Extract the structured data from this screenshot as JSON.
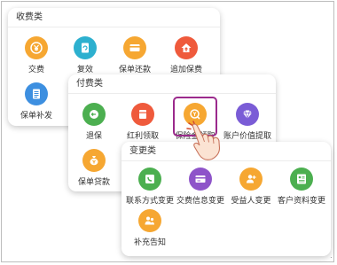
{
  "panels": {
    "shoufei": {
      "title": "收费类",
      "items": [
        {
          "label": "交费",
          "icon": "yen-circle-icon",
          "color": "#f6a732"
        },
        {
          "label": "复效",
          "icon": "refresh-document-icon",
          "color": "#2db0cf"
        },
        {
          "label": "保单还款",
          "icon": "card-icon",
          "color": "#f6a732"
        },
        {
          "label": "追加保费",
          "icon": "house-up-icon",
          "color": "#ef5a3c"
        },
        {
          "label": "保单补发",
          "icon": "document-icon",
          "color": "#3d8fe0"
        }
      ]
    },
    "fufei": {
      "title": "付费类",
      "items": [
        {
          "label": "退保",
          "icon": "return-badge-icon",
          "color": "#4caf50"
        },
        {
          "label": "红利领取",
          "icon": "bag-icon",
          "color": "#ef5a3c"
        },
        {
          "label": "保险金领取",
          "icon": "yen-search-icon",
          "color": "#f6a732"
        },
        {
          "label": "账户价值提取",
          "icon": "diamond-icon",
          "color": "#7a5cd6"
        },
        {
          "label": "保单贷款",
          "icon": "money-bag-icon",
          "color": "#f6a732"
        }
      ]
    },
    "biangeng": {
      "title": "变更类",
      "items": [
        {
          "label": "联系方式变更",
          "icon": "phone-icon",
          "color": "#4caf50"
        },
        {
          "label": "交费信息变更",
          "icon": "card-edit-icon",
          "color": "#8e54c9"
        },
        {
          "label": "受益人变更",
          "icon": "beneficiary-icon",
          "color": "#f6a732"
        },
        {
          "label": "客户资料变更",
          "icon": "id-card-icon",
          "color": "#4caf50"
        },
        {
          "label": "补充告知",
          "icon": "people-icon",
          "color": "#f6a732"
        }
      ]
    }
  },
  "highlight_color": "#9b2a8c",
  "pointer": {
    "icon": "hand-pointer-icon"
  },
  "edge_mark": "·"
}
